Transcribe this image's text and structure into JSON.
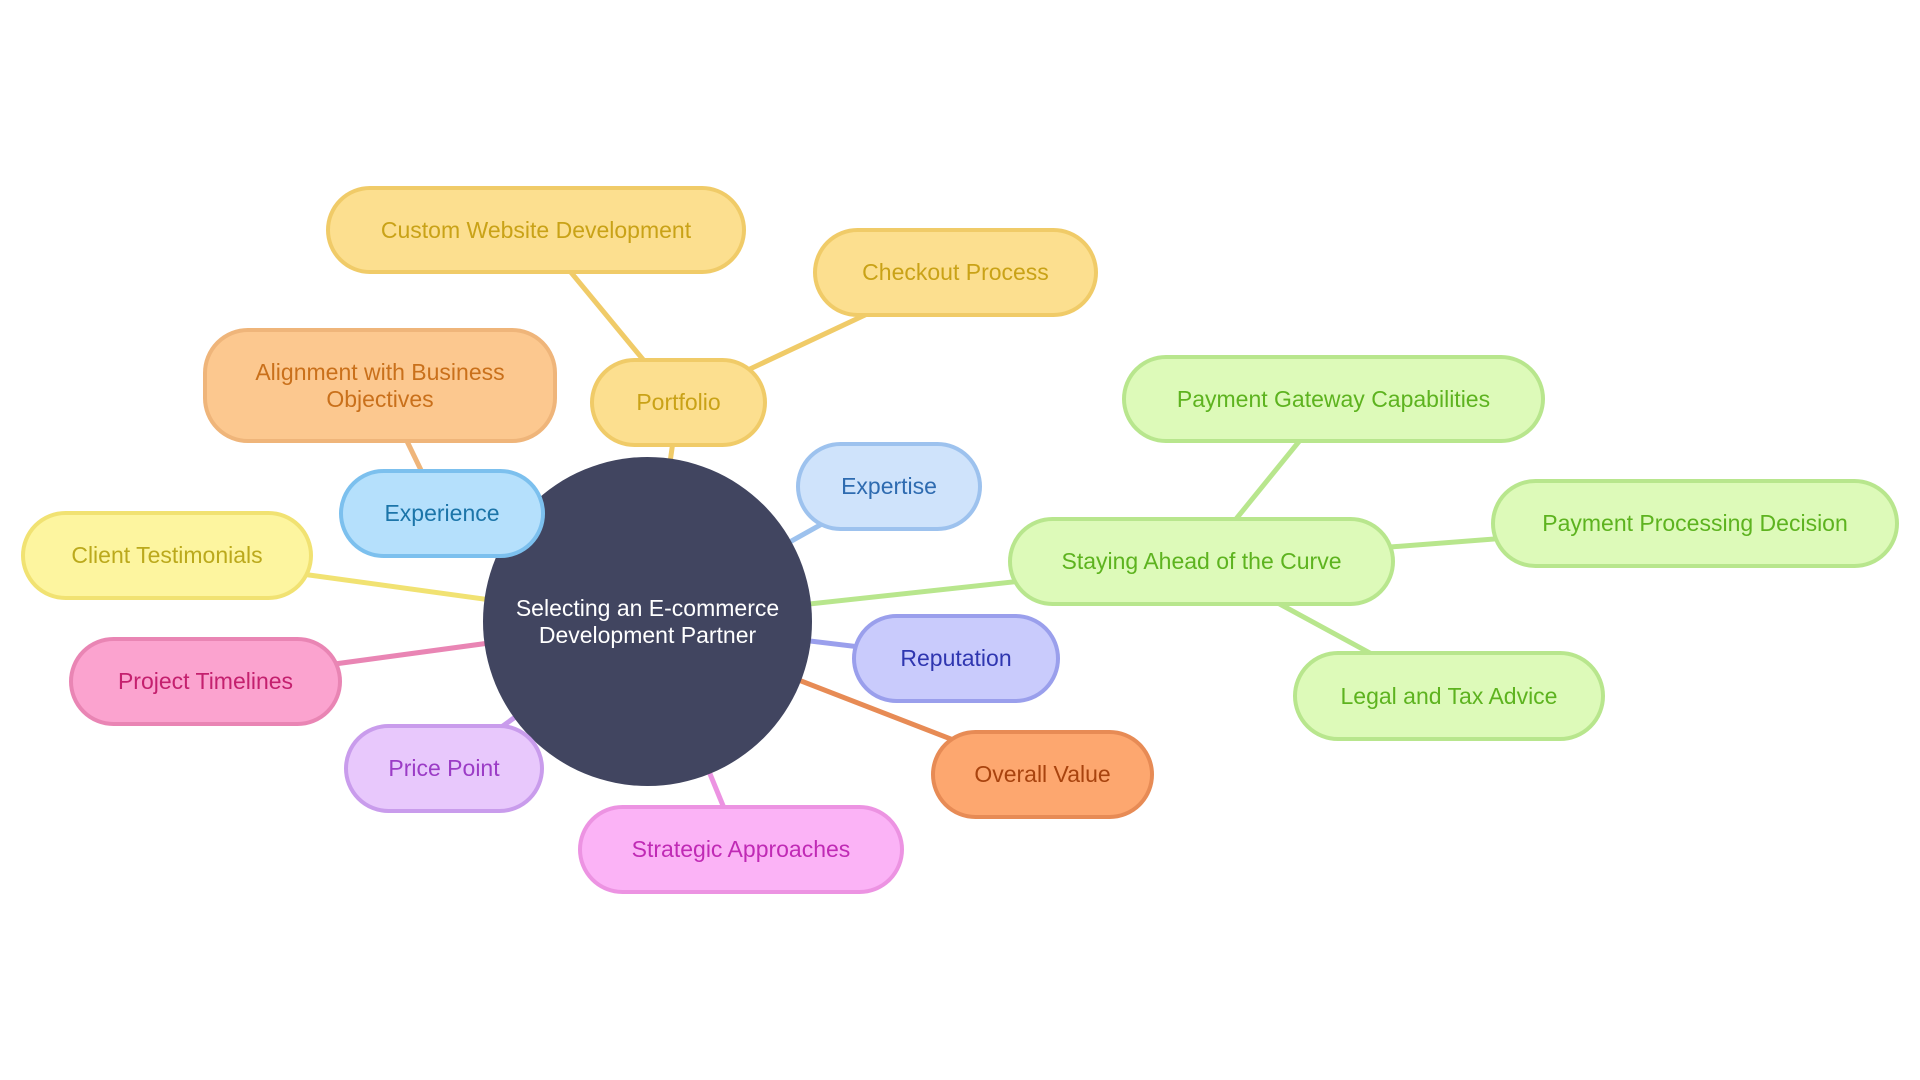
{
  "diagram": {
    "type": "mindmap",
    "root": {
      "id": "root",
      "label": "Selecting an E-commerce Development Partner",
      "fill": "#414560",
      "text": "#ffffff"
    },
    "nodes": [
      {
        "id": "portfolio",
        "label": "Portfolio",
        "parent": "root",
        "fill": "#FCDF8F",
        "stroke": "#F0CB68",
        "text": "#C9A217",
        "edge": "#F0CB68"
      },
      {
        "id": "custom-website-development",
        "label": "Custom Website Development",
        "parent": "portfolio",
        "fill": "#FCDF8F",
        "stroke": "#F0CB68",
        "text": "#C9A217",
        "edge": "#F0CB68"
      },
      {
        "id": "checkout-process",
        "label": "Checkout Process",
        "parent": "portfolio",
        "fill": "#FCDF8F",
        "stroke": "#F0CB68",
        "text": "#C9A217",
        "edge": "#F0CB68"
      },
      {
        "id": "experience",
        "label": "Experience",
        "parent": "root",
        "fill": "#B5E0FC",
        "stroke": "#7CC0EE",
        "text": "#1C75A9",
        "edge": "#7CC0EE"
      },
      {
        "id": "alignment-with-business-objectives",
        "label": "Alignment with Business Objectives",
        "parent": "experience",
        "fill": "#FCC88F",
        "stroke": "#EFB57A",
        "text": "#C9701B",
        "edge": "#EFB57A"
      },
      {
        "id": "expertise",
        "label": "Expertise",
        "parent": "root",
        "fill": "#CFE3FB",
        "stroke": "#9DC2EE",
        "text": "#2E6BB0",
        "edge": "#9DC2EE"
      },
      {
        "id": "client-testimonials",
        "label": "Client Testimonials",
        "parent": "root",
        "fill": "#FDF59F",
        "stroke": "#F1E272",
        "text": "#BBA91C",
        "edge": "#F1E272"
      },
      {
        "id": "project-timelines",
        "label": "Project Timelines",
        "parent": "root",
        "fill": "#FBA3CF",
        "stroke": "#E985B4",
        "text": "#C4206E",
        "edge": "#E985B4"
      },
      {
        "id": "price-point",
        "label": "Price Point",
        "parent": "root",
        "fill": "#E8C8FC",
        "stroke": "#C99CEC",
        "text": "#9B3CC6",
        "edge": "#C99CEC"
      },
      {
        "id": "strategic-approaches",
        "label": "Strategic Approaches",
        "parent": "root",
        "fill": "#FBB3F6",
        "stroke": "#EC93E2",
        "text": "#C02AB5",
        "edge": "#EC93E2"
      },
      {
        "id": "overall-value",
        "label": "Overall Value",
        "parent": "root",
        "fill": "#FDA76F",
        "stroke": "#E78B55",
        "text": "#A8430E",
        "edge": "#E78B55"
      },
      {
        "id": "reputation",
        "label": "Reputation",
        "parent": "root",
        "fill": "#C9CBFC",
        "stroke": "#9A9FEC",
        "text": "#2F36B0",
        "edge": "#9A9FEC"
      },
      {
        "id": "staying-ahead-of-the-curve",
        "label": "Staying Ahead of the Curve",
        "parent": "root",
        "fill": "#DDFAB9",
        "stroke": "#B8E68D",
        "text": "#5DB31F",
        "edge": "#B8E68D"
      },
      {
        "id": "payment-gateway-capabilities",
        "label": "Payment Gateway Capabilities",
        "parent": "staying-ahead-of-the-curve",
        "fill": "#DDFAB9",
        "stroke": "#B8E68D",
        "text": "#5DB31F",
        "edge": "#B8E68D"
      },
      {
        "id": "payment-processing-decision",
        "label": "Payment Processing Decision",
        "parent": "staying-ahead-of-the-curve",
        "fill": "#DDFAB9",
        "stroke": "#B8E68D",
        "text": "#5DB31F",
        "edge": "#B8E68D"
      },
      {
        "id": "legal-and-tax-advice",
        "label": "Legal and Tax Advice",
        "parent": "staying-ahead-of-the-curve",
        "fill": "#DDFAB9",
        "stroke": "#B8E68D",
        "text": "#5DB31F",
        "edge": "#B8E68D"
      }
    ]
  }
}
